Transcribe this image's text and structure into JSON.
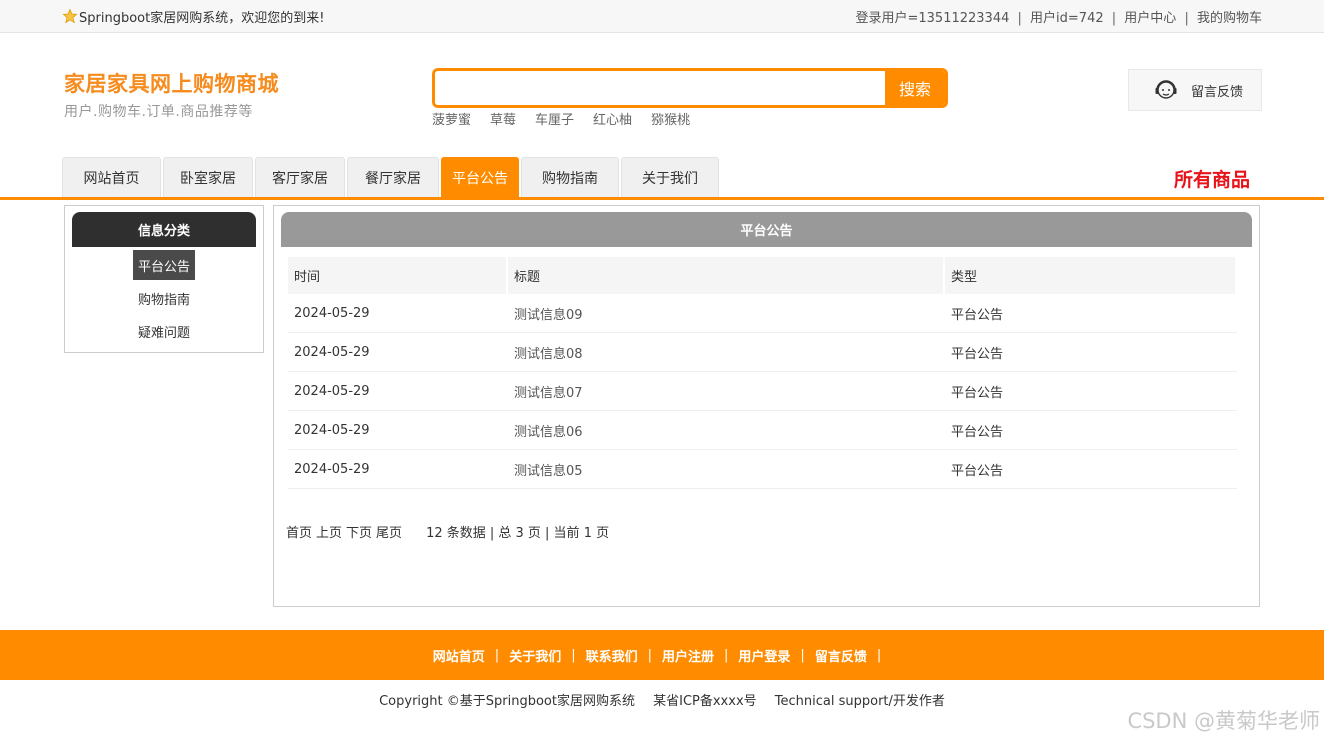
{
  "topbar": {
    "welcome": "Springboot家居网购系统，欢迎您的到来!",
    "login_user": "登录用户=13511223344",
    "user_id": "用户id=742",
    "user_center": "用户中心",
    "cart": "我的购物车",
    "separator": "|"
  },
  "brand": {
    "title": "家居家具网上购物商城",
    "subtitle": "用户.购物车.订单.商品推荐等"
  },
  "search": {
    "value": "",
    "button": "搜索",
    "hotwords": [
      "菠萝蜜",
      "草莓",
      "车厘子",
      "红心柚",
      "猕猴桃"
    ]
  },
  "feedback": {
    "label": "留言反馈"
  },
  "nav": {
    "tabs": [
      "网站首页",
      "卧室家居",
      "客厅家居",
      "餐厅家居",
      "平台公告",
      "购物指南",
      "关于我们"
    ],
    "active": "平台公告",
    "all_goods": "所有商品"
  },
  "sidebar": {
    "title": "信息分类",
    "items": [
      "平台公告",
      "购物指南",
      "疑难问题"
    ],
    "active": "平台公告"
  },
  "panel": {
    "title": "平台公告",
    "columns": [
      "时间",
      "标题",
      "类型"
    ],
    "rows": [
      [
        "2024-05-29",
        "测试信息09",
        "平台公告"
      ],
      [
        "2024-05-29",
        "测试信息08",
        "平台公告"
      ],
      [
        "2024-05-29",
        "测试信息07",
        "平台公告"
      ],
      [
        "2024-05-29",
        "测试信息06",
        "平台公告"
      ],
      [
        "2024-05-29",
        "测试信息05",
        "平台公告"
      ]
    ]
  },
  "pager": {
    "first": "首页",
    "prev": "上页",
    "next": "下页",
    "last": "尾页",
    "info": "12 条数据 | 总 3 页 | 当前 1 页"
  },
  "footer": {
    "links": [
      "网站首页",
      "关于我们",
      "联系我们",
      "用户注册",
      "用户登录",
      "留言反馈"
    ],
    "separator": "|",
    "copyright": "Copyright ©基于Springboot家居网购系统",
    "icp": "某省ICP备xxxx号",
    "support": "Technical support/开发作者"
  },
  "watermark": "CSDN @黄菊华老师",
  "colors": {
    "accent": "#ff8c00",
    "brand": "#f68b1e",
    "all_goods": "#e8121a"
  }
}
